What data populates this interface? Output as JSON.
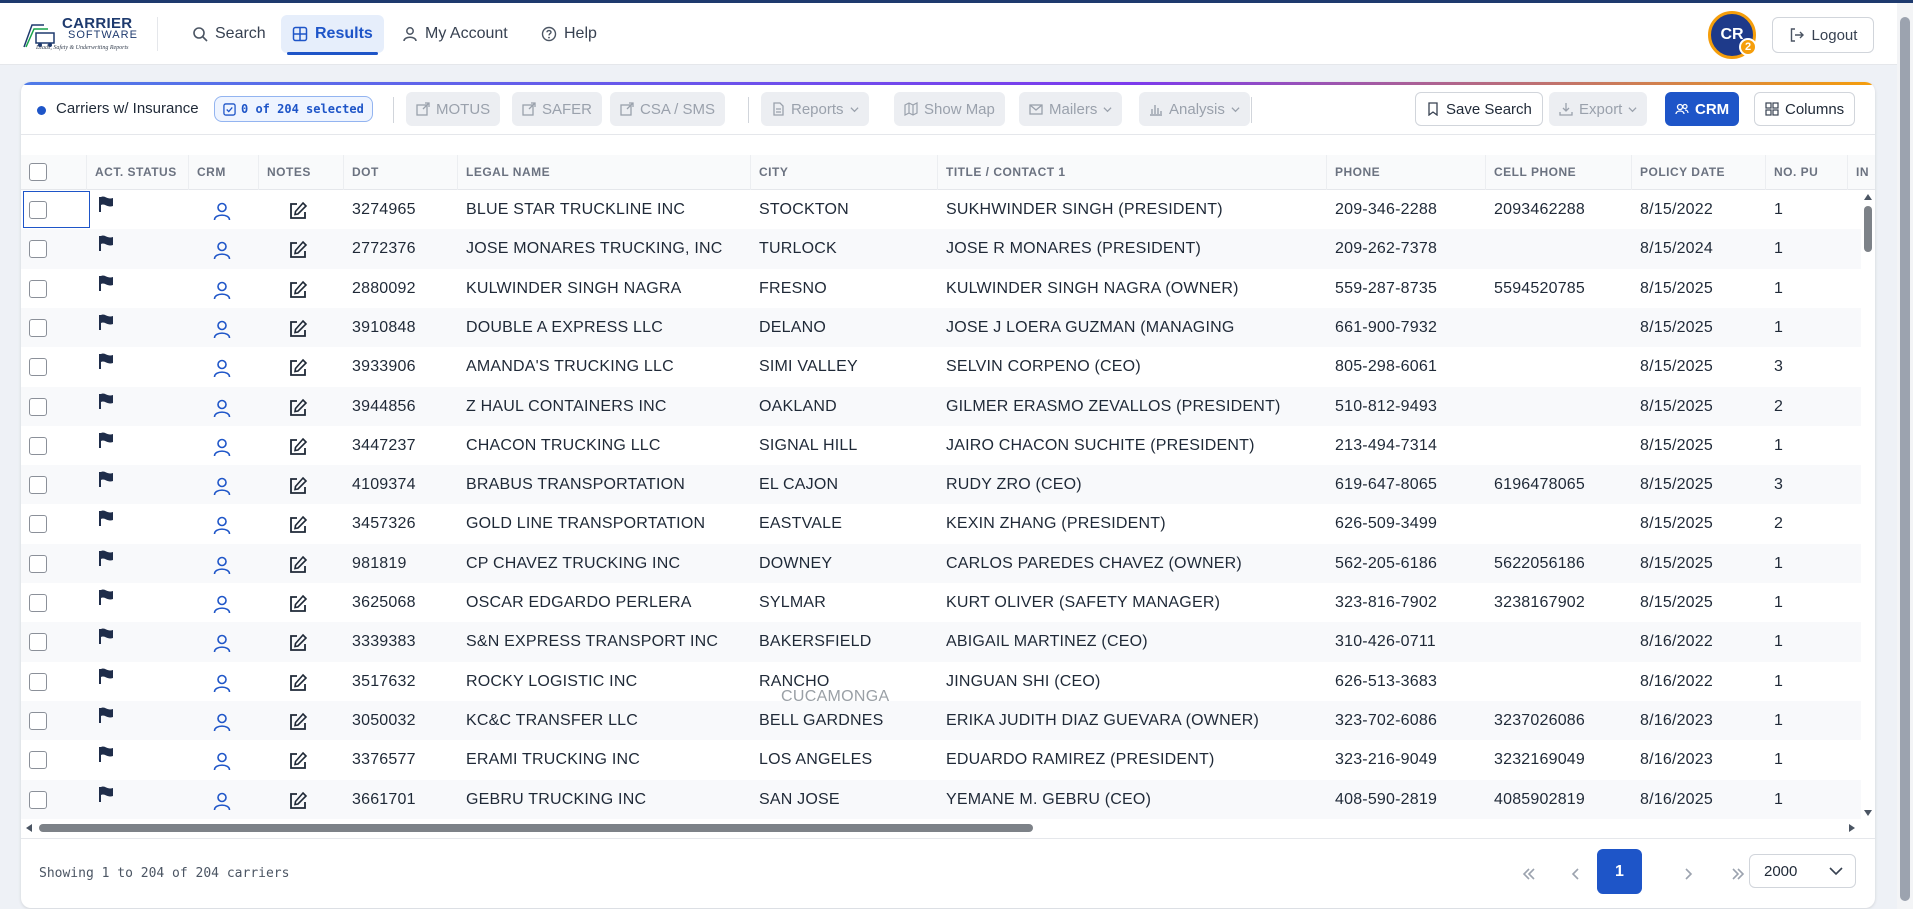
{
  "nav": {
    "logo": {
      "line1": "CARRIER",
      "line2": "SOFTWARE",
      "tagline": "Leads, Safety & Underwriting Reports"
    },
    "items": [
      {
        "label": "Search",
        "icon": "search-icon"
      },
      {
        "label": "Results",
        "icon": "table-icon",
        "active": true
      },
      {
        "label": "My Account",
        "icon": "user-icon"
      },
      {
        "label": "Help",
        "icon": "help-icon"
      }
    ],
    "avatar": {
      "initials": "CR",
      "badge": "2"
    },
    "logout_label": "Logout"
  },
  "toolbar": {
    "filter_label": "Carriers w/ Insurance",
    "selected_label": "0 of 204 selected",
    "buttons": {
      "motus": "MOTUS",
      "safer": "SAFER",
      "csa": "CSA / SMS",
      "reports": "Reports",
      "show_map": "Show Map",
      "mailers": "Mailers",
      "analysis": "Analysis",
      "save_search": "Save Search",
      "export": "Export",
      "crm": "CRM",
      "columns": "Columns"
    }
  },
  "table": {
    "columns": [
      "ACT. STATUS",
      "CRM",
      "NOTES",
      "DOT",
      "LEGAL NAME",
      "CITY",
      "TITLE / CONTACT 1",
      "PHONE",
      "CELL PHONE",
      "POLICY DATE",
      "NO. PU",
      "IN"
    ],
    "rows": [
      {
        "dot": "3274965",
        "name": "BLUE STAR TRUCKLINE INC",
        "city": "STOCKTON",
        "contact": "SUKHWINDER SINGH (PRESIDENT)",
        "phone": "209-346-2288",
        "cell": "2093462288",
        "policy": "8/15/2022",
        "pu": "1"
      },
      {
        "dot": "2772376",
        "name": "JOSE MONARES TRUCKING, INC",
        "city": "TURLOCK",
        "contact": "JOSE R MONARES (PRESIDENT)",
        "phone": "209-262-7378",
        "cell": "",
        "policy": "8/15/2024",
        "pu": "1"
      },
      {
        "dot": "2880092",
        "name": "KULWINDER SINGH NAGRA",
        "city": "FRESNO",
        "contact": "KULWINDER SINGH NAGRA (OWNER)",
        "phone": "559-287-8735",
        "cell": "5594520785",
        "policy": "8/15/2025",
        "pu": "1"
      },
      {
        "dot": "3910848",
        "name": "DOUBLE A EXPRESS LLC",
        "city": "DELANO",
        "contact": "JOSE J LOERA GUZMAN (MANAGING",
        "phone": "661-900-7932",
        "cell": "",
        "policy": "8/15/2025",
        "pu": "1"
      },
      {
        "dot": "3933906",
        "name": "AMANDA'S TRUCKING LLC",
        "city": "SIMI VALLEY",
        "contact": "SELVIN CORPENO (CEO)",
        "phone": "805-298-6061",
        "cell": "",
        "policy": "8/15/2025",
        "pu": "3"
      },
      {
        "dot": "3944856",
        "name": "Z HAUL CONTAINERS INC",
        "city": "OAKLAND",
        "contact": "GILMER ERASMO ZEVALLOS (PRESIDENT)",
        "phone": "510-812-9493",
        "cell": "",
        "policy": "8/15/2025",
        "pu": "2"
      },
      {
        "dot": "3447237",
        "name": "CHACON TRUCKING LLC",
        "city": "SIGNAL HILL",
        "contact": "JAIRO CHACON SUCHITE (PRESIDENT)",
        "phone": "213-494-7314",
        "cell": "",
        "policy": "8/15/2025",
        "pu": "1"
      },
      {
        "dot": "4109374",
        "name": "BRABUS TRANSPORTATION",
        "city": "EL CAJON",
        "contact": "RUDY ZRO (CEO)",
        "phone": "619-647-8065",
        "cell": "6196478065",
        "policy": "8/15/2025",
        "pu": "3"
      },
      {
        "dot": "3457326",
        "name": "GOLD LINE TRANSPORTATION",
        "city": "EASTVALE",
        "contact": "KEXIN ZHANG (PRESIDENT)",
        "phone": "626-509-3499",
        "cell": "",
        "policy": "8/15/2025",
        "pu": "2"
      },
      {
        "dot": "981819",
        "name": "CP CHAVEZ TRUCKING INC",
        "city": "DOWNEY",
        "contact": "CARLOS PAREDES CHAVEZ (OWNER)",
        "phone": "562-205-6186",
        "cell": "5622056186",
        "policy": "8/15/2025",
        "pu": "1"
      },
      {
        "dot": "3625068",
        "name": "OSCAR EDGARDO PERLERA",
        "city": "SYLMAR",
        "contact": "KURT OLIVER (SAFETY MANAGER)",
        "phone": "323-816-7902",
        "cell": "3238167902",
        "policy": "8/15/2025",
        "pu": "1"
      },
      {
        "dot": "3339383",
        "name": "S&N EXPRESS TRANSPORT INC",
        "city": "BAKERSFIELD",
        "contact": "ABIGAIL MARTINEZ (CEO)",
        "phone": "310-426-0711",
        "cell": "",
        "policy": "8/16/2022",
        "pu": "1"
      },
      {
        "dot": "3517632",
        "name": "ROCKY LOGISTIC INC",
        "city": "RANCHO",
        "city2": "CUCAMONGA",
        "contact": "JINGUAN SHI (CEO)",
        "phone": "626-513-3683",
        "cell": "",
        "policy": "8/16/2022",
        "pu": "1"
      },
      {
        "dot": "3050032",
        "name": "KC&C TRANSFER LLC",
        "city": "BELL GARDNES",
        "contact": "ERIKA JUDITH DIAZ GUEVARA (OWNER)",
        "phone": "323-702-6086",
        "cell": "3237026086",
        "policy": "8/16/2023",
        "pu": "1"
      },
      {
        "dot": "3376577",
        "name": "ERAMI TRUCKING INC",
        "city": "LOS ANGELES",
        "contact": "EDUARDO RAMIREZ (PRESIDENT)",
        "phone": "323-216-9049",
        "cell": "3232169049",
        "policy": "8/16/2023",
        "pu": "1"
      },
      {
        "dot": "3661701",
        "name": "GEBRU TRUCKING INC",
        "city": "SAN JOSE",
        "contact": "YEMANE M. GEBRU (CEO)",
        "phone": "408-590-2819",
        "cell": "4085902819",
        "policy": "8/16/2025",
        "pu": "1"
      }
    ]
  },
  "footer": {
    "showing": "Showing 1 to 204 of 204 carriers",
    "current_page": "1",
    "page_size": "2000"
  },
  "colors": {
    "accent": "#1e55c8",
    "brand": "#1e3a6e",
    "badge": "#f59e0b"
  }
}
